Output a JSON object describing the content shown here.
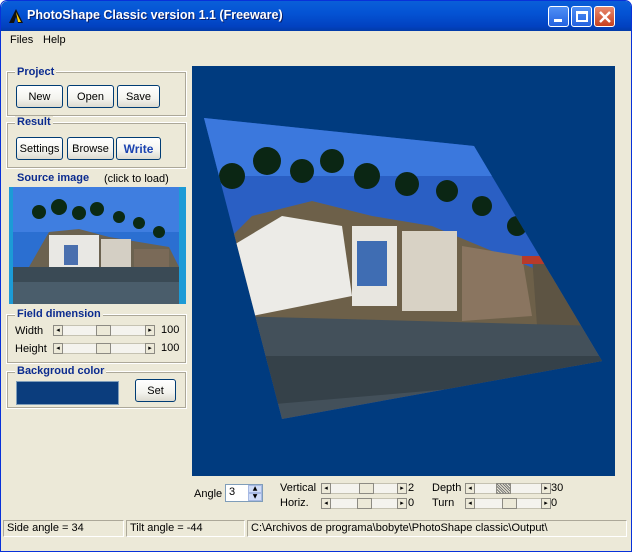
{
  "window": {
    "title": "PhotoShape Classic version 1.1 (Freeware)"
  },
  "menu": {
    "files": "Files",
    "help": "Help"
  },
  "project": {
    "title": "Project",
    "new": "New",
    "open": "Open",
    "save": "Save"
  },
  "result": {
    "title": "Result",
    "settings": "Settings",
    "browse": "Browse",
    "write": "Write"
  },
  "source": {
    "title": "Source image",
    "hint": "(click to load)"
  },
  "field": {
    "title": "Field dimension",
    "width_label": "Width",
    "width_value": "100",
    "height_label": "Height",
    "height_value": "100"
  },
  "background": {
    "title": "Backgroud color",
    "color": "#0b3d7d",
    "set": "Set"
  },
  "controls": {
    "angle_label": "Angle",
    "angle_value": "3",
    "vertical_label": "Vertical",
    "vertical_value": "2",
    "horiz_label": "Horiz.",
    "horiz_value": "0",
    "depth_label": "Depth",
    "depth_value": "30",
    "turn_label": "Turn",
    "turn_value": "0"
  },
  "status": {
    "side": "Side angle = 34",
    "tilt": "Tilt angle = -44",
    "path": "C:\\Archivos de programa\\bobyte\\PhotoShape classic\\Output\\"
  }
}
